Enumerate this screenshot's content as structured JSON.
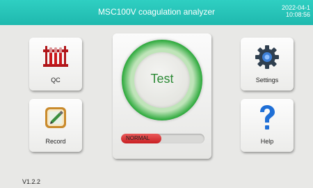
{
  "header": {
    "title": "MSC100V coagulation analyzer",
    "date": "2022-04-1",
    "time": "10:08:56",
    "color": "#24c0b4"
  },
  "tiles": {
    "qc": {
      "label": "QC",
      "icon": "test-tubes-icon"
    },
    "record": {
      "label": "Record",
      "icon": "record-book-icon"
    },
    "settings": {
      "label": "Settings",
      "icon": "gear-icon"
    },
    "help": {
      "label": "Help",
      "icon": "question-mark-icon"
    }
  },
  "test_panel": {
    "button_label": "Test",
    "status": "NORMAL",
    "status_color": "#d83a3a",
    "ring_color": "#2eaa3d"
  },
  "footer": {
    "version": "V1.2.2"
  }
}
